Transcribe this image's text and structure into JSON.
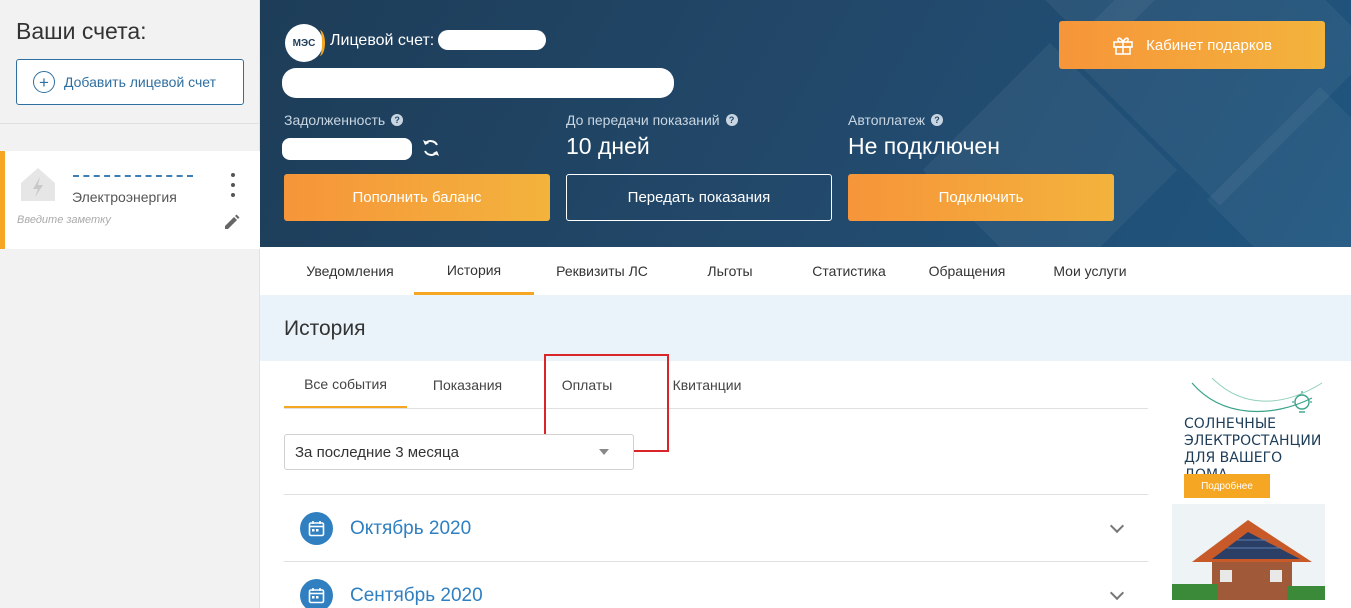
{
  "sidebar": {
    "title": "Ваши счета:",
    "add_account_label": "Добавить лицевой счет",
    "account": {
      "type": "Электроэнергия",
      "note_placeholder": "Введите заметку"
    }
  },
  "header": {
    "logo_text": "МЭС",
    "account_label": "Лицевой счет:",
    "gift_button_label": "Кабинет подарков",
    "stats": {
      "debt_label": "Задолженность",
      "days_label": "До передачи показаний",
      "days_value": "10 дней",
      "autopay_label": "Автоплатеж",
      "autopay_value": "Не подключен"
    },
    "buttons": {
      "topup": "Пополнить баланс",
      "readings": "Передать показания",
      "connect": "Подключить"
    }
  },
  "main_tabs": [
    "Уведомления",
    "История",
    "Реквизиты ЛС",
    "Льготы",
    "Статистика",
    "Обращения",
    "Мои услуги"
  ],
  "history": {
    "title": "История",
    "sub_tabs": [
      "Все события",
      "Показания",
      "Оплаты",
      "Квитанции"
    ],
    "period": "За последние 3 месяца",
    "months": [
      "Октябрь 2020",
      "Сентябрь 2020"
    ]
  },
  "ad": {
    "title": "СОЛНЕЧНЫЕ ЭЛЕКТРОСТАНЦИИ ДЛЯ ВАШЕГО ДОМА",
    "button": "Подробнее"
  },
  "colors": {
    "accent_orange": "#f5a623",
    "banner_blue": "#22486a",
    "link_blue": "#2f7fc1",
    "highlight_red": "#d9252a"
  }
}
